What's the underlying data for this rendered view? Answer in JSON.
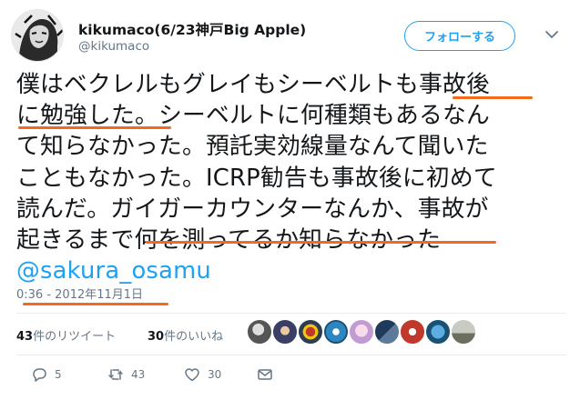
{
  "header": {
    "display_name": "kikumaco(6/23神戸Big Apple)",
    "handle": "@kikumaco",
    "follow_label": "フォローする",
    "avatar_icon": "user-avatar-icon",
    "caret_icon": "chevron-down-icon"
  },
  "tweet": {
    "lines": [
      "僕はベクレルもグレイもシーベルトも事故後",
      "に勉強した。シーベルトに何種類もあるなん",
      "て知らなかった。預託実効線量なんて聞いた",
      "こともなかった。ICRP勧告も事故後に初めて",
      "読んだ。ガイガーカウンターなんか、事故が",
      "起きるまで何を測ってるか知らなかった"
    ],
    "mention": "@sakura_osamu"
  },
  "timestamp": "0:36 - 2012年11月1日",
  "stats": {
    "retweets_count": "43",
    "retweets_label": "件のリツイート",
    "likes_count": "30",
    "likes_label": "件のいいね"
  },
  "actions": {
    "reply_count": "5",
    "retweet_count": "43",
    "like_count": "30",
    "reply_icon": "reply-icon",
    "retweet_icon": "retweet-icon",
    "like_icon": "heart-icon",
    "dm_icon": "envelope-icon"
  },
  "colors": {
    "accent": "#1da1f2",
    "highlight_underline": "#f26a1b",
    "muted_text": "#657786"
  }
}
